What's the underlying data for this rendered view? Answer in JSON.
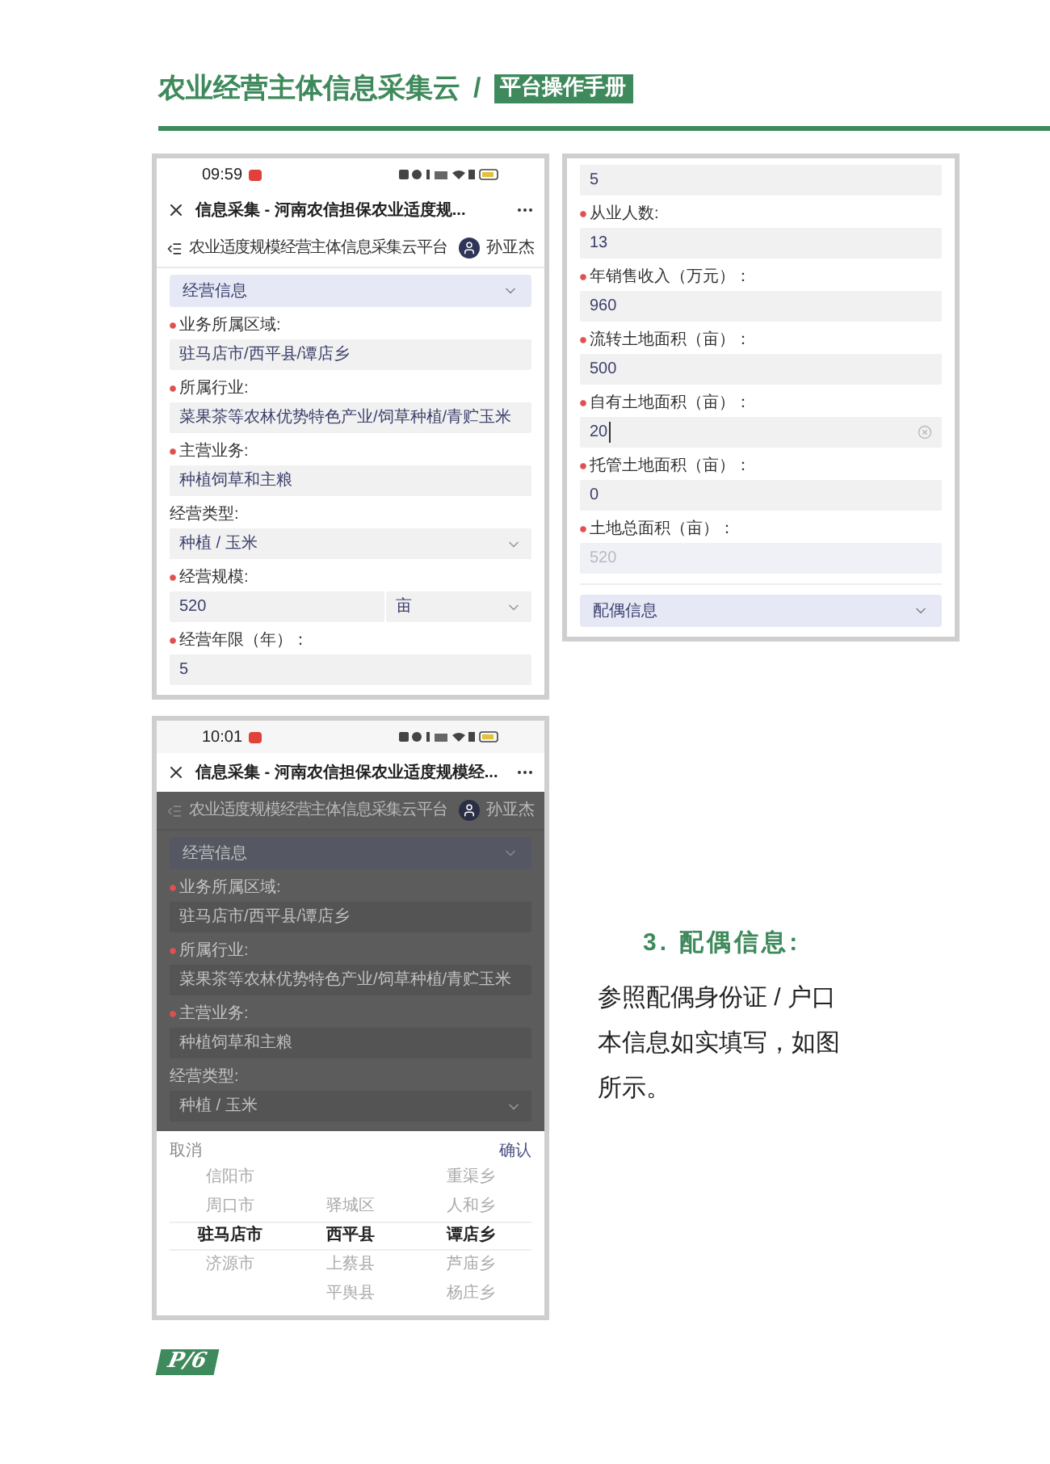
{
  "header": {
    "title": "农业经营主体信息采集云",
    "separator": "/",
    "subtitle": "平台操作手册"
  },
  "screens": [
    {
      "kind": "form",
      "dimmed": false,
      "time": "09:59",
      "title": "信息采集 - 河南农信担保农业适度规...",
      "platform": "农业适度规模经营主体信息采集云平台",
      "user": "孙亚杰",
      "section_top": "经营信息",
      "fields": [
        {
          "kind": "text",
          "label": "业务所属区域:",
          "required": true,
          "value": "驻马店市/西平县/谭店乡"
        },
        {
          "kind": "text",
          "label": "所属行业:",
          "required": true,
          "value": "菜果茶等农林优势特色产业/饲草种植/青贮玉米"
        },
        {
          "kind": "text",
          "label": "主营业务:",
          "required": true,
          "value": "种植饲草和主粮"
        },
        {
          "kind": "select",
          "label": "经营类型:",
          "required": false,
          "value": "种植 / 玉米"
        },
        {
          "kind": "unit",
          "label": "经营规模:",
          "required": true,
          "value": "520",
          "unit": "亩"
        },
        {
          "kind": "text",
          "label": "经营年限（年）：",
          "required": true,
          "value": "5"
        }
      ]
    },
    {
      "kind": "form_continued",
      "dimmed": false,
      "fields": [
        {
          "kind": "text",
          "value": "5"
        },
        {
          "kind": "text",
          "label": "从业人数:",
          "required": true,
          "value": "13"
        },
        {
          "kind": "text",
          "label": "年销售收入（万元）：",
          "required": true,
          "value": "960"
        },
        {
          "kind": "text",
          "label": "流转土地面积（亩）：",
          "required": true,
          "value": "500"
        },
        {
          "kind": "clearable",
          "label": "自有土地面积（亩）：",
          "required": true,
          "value": "20"
        },
        {
          "kind": "text",
          "label": "托管土地面积（亩）：",
          "required": true,
          "value": "0"
        },
        {
          "kind": "readonly",
          "label": "土地总面积（亩）：",
          "required": true,
          "value": "520"
        }
      ],
      "section_bottom": "配偶信息"
    },
    {
      "kind": "picker",
      "dimmed": true,
      "time": "10:01",
      "title": "信息采集 - 河南农信担保农业适度规模经...",
      "platform": "农业适度规模经营主体信息采集云平台",
      "user": "孙亚杰",
      "section_top": "经营信息",
      "fields": [
        {
          "kind": "text",
          "label": "业务所属区域:",
          "required": true,
          "value": "驻马店市/西平县/谭店乡"
        },
        {
          "kind": "text",
          "label": "所属行业:",
          "required": true,
          "value": "菜果茶等农林优势特色产业/饲草种植/青贮玉米"
        },
        {
          "kind": "text",
          "label": "主营业务:",
          "required": true,
          "value": "种植饲草和主粮"
        },
        {
          "kind": "select",
          "label": "经营类型:",
          "required": false,
          "value": "种植 / 玉米"
        }
      ],
      "picker": {
        "cancel": "取消",
        "confirm": "确认",
        "columns": [
          [
            {
              "label": "信阳市",
              "selected": false
            },
            {
              "label": "周口市",
              "selected": false
            },
            {
              "label": "驻马店市",
              "selected": true
            },
            {
              "label": "济源市",
              "selected": false
            }
          ],
          [
            {
              "label": "驿城区",
              "selected": false
            },
            {
              "label": "西平县",
              "selected": true
            },
            {
              "label": "上蔡县",
              "selected": false
            },
            {
              "label": "平舆县",
              "selected": false
            }
          ],
          [
            {
              "label": "重渠乡",
              "selected": false
            },
            {
              "label": "人和乡",
              "selected": false
            },
            {
              "label": "谭店乡",
              "selected": true
            },
            {
              "label": "芦庙乡",
              "selected": false
            },
            {
              "label": "杨庄乡",
              "selected": false
            }
          ]
        ]
      }
    }
  ],
  "instructions": {
    "heading": "3. 配偶信息:",
    "body": "参照配偶身份证 / 户口本信息如实填写，如图所示。"
  },
  "footer": {
    "page": "P/6"
  }
}
